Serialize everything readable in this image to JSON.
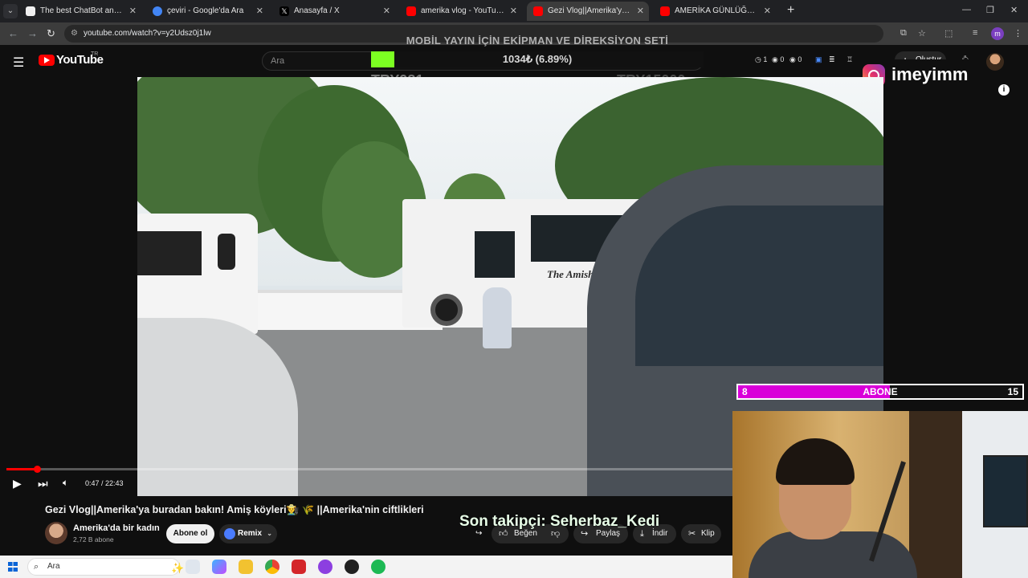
{
  "browser": {
    "tabs": [
      {
        "title": "The best ChatBot and Widgets",
        "fav": "#f0f0f0",
        "active": false
      },
      {
        "title": "çeviri - Google'da Ara",
        "fav": "#4285f4",
        "active": false
      },
      {
        "title": "Anasayfa / X",
        "fav": "#000000",
        "active": false
      },
      {
        "title": "amerika vlog - YouTube",
        "fav": "#ff0000",
        "active": false
      },
      {
        "title": "Gezi Vlog||Amerika'ya buradan",
        "fav": "#ff0000",
        "active": true
      },
      {
        "title": "AMERİKA GÜNLÜĞÜM | VLOG",
        "fav": "#ff0000",
        "active": false
      }
    ],
    "url": "youtube.com/watch?v=y2Udsz0j1lw",
    "profile_initial": "m"
  },
  "youtube": {
    "logo_text": "YouTube",
    "country_code": "TR",
    "search_placeholder": "Ara",
    "create_label": "Oluştur",
    "counters": {
      "a": "1",
      "b": "0",
      "c": "0"
    }
  },
  "overlay": {
    "donation_title": "MOBİL YAYIN İÇİN EKİPMAN VE DİREKSİYON SETİ",
    "donation_amount": "1034₺ (6.89%)",
    "donation_progress": 0.0689,
    "donation_left": "TRY981",
    "donation_right": "TRY15000",
    "instagram_handle": "imeyimm",
    "sub_goal_current": "8",
    "sub_goal_label": "ABONE",
    "sub_goal_target": "15",
    "last_follower": "Son takipçi: Seherbaz_Kedi"
  },
  "video": {
    "bus_text": "The Amish Village",
    "current_time": "0:47",
    "duration": "22:43",
    "time_display": "0:47 / 22:43",
    "progress": 0.0345,
    "title": "Gezi Vlog||Amerika'ya buradan bakın! Amiş köyleri👨‍🌾 🌾 ||Amerika'nin ciftlikleri"
  },
  "channel": {
    "name": "Amerika'da bir kadın",
    "subscribers": "2,72 B abone",
    "subscribe_label": "Abone ol",
    "remix_label": "Remix"
  },
  "actions": {
    "like": "Beğen",
    "share": "Paylaş",
    "download": "İndir",
    "clip": "Klip"
  },
  "taskbar": {
    "search_placeholder": "Ara"
  },
  "colors": {
    "yt_red": "#ff0000",
    "donation_green": "#7cff22",
    "sub_goal_magenta": "#d900d9"
  }
}
